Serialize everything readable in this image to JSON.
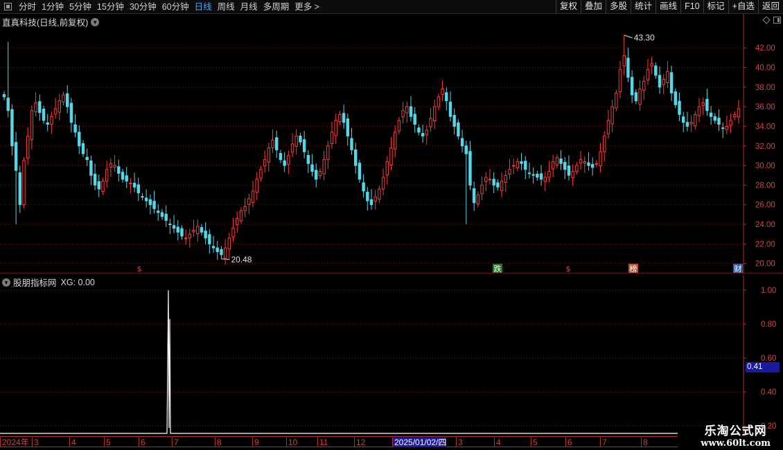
{
  "toolbar": {
    "periods": [
      "分时",
      "1分钟",
      "5分钟",
      "15分钟",
      "30分钟",
      "60分钟",
      "日线",
      "周线",
      "月线",
      "多周期",
      "更多 >"
    ],
    "active_period": "日线",
    "actions": [
      "复权",
      "叠加",
      "多股",
      "统计",
      "画线",
      "F10",
      "标记",
      "+自选",
      "返回"
    ]
  },
  "price_panel": {
    "title": "直真科技(日线,前复权)",
    "high_label": "43.30",
    "low_label": "20.48",
    "markers": [
      {
        "text": "$",
        "color": "#ff3b3b",
        "bg": "transparent"
      },
      {
        "text": "跌",
        "color": "#ffffff",
        "bg": "#1f7a1f"
      },
      {
        "text": "$",
        "color": "#ff3b3b",
        "bg": "transparent"
      },
      {
        "text": "榜",
        "color": "#ffffff",
        "bg": "#c0502a"
      },
      {
        "text": "财",
        "color": "#ffffff",
        "bg": "#2a5fb0"
      }
    ]
  },
  "indicator_panel": {
    "title": "股朋指标网",
    "value_label": "XG: 0.00",
    "current_value": "0.41"
  },
  "date_axis": [
    "2024年",
    "3",
    "4",
    "5",
    "6",
    "7",
    "8",
    "9",
    "10",
    "11",
    "12",
    "2025/01/02/四",
    "3",
    "4",
    "5",
    "6",
    "7",
    "8"
  ],
  "watermark": {
    "line1": "乐淘公式网",
    "line2": "www.60lt.com"
  },
  "colors": {
    "up": "#ff3b3b",
    "down": "#54d8e8",
    "grid": "#7a1515",
    "axis": "#b03030",
    "accent": "#4aa3ff"
  },
  "chart_data": [
    {
      "type": "candlestick",
      "title": "直真科技(日线,前复权)",
      "y_ticks": [
        "20.00",
        "22.00",
        "24.00",
        "26.00",
        "28.00",
        "30.00",
        "32.00",
        "34.00",
        "36.00",
        "38.00",
        "40.00",
        "42.00"
      ],
      "ylim": [
        19.2,
        44.2
      ],
      "x_labels": [
        "2024年",
        "3",
        "4",
        "5",
        "6",
        "7",
        "8",
        "9",
        "10",
        "11",
        "12",
        "2025/01/02/四",
        "3",
        "4",
        "5",
        "6",
        "7",
        "8"
      ],
      "grid": true,
      "closes": [
        37.0,
        35.6,
        32.0,
        29.5,
        26.0,
        30.5,
        33.0,
        35.6,
        36.4,
        35.4,
        34.6,
        34.2,
        35.0,
        35.8,
        36.6,
        37.2,
        36.0,
        34.4,
        33.4,
        32.0,
        31.2,
        30.6,
        29.0,
        28.0,
        27.6,
        28.4,
        29.6,
        30.2,
        30.0,
        29.2,
        28.6,
        28.4,
        28.2,
        27.8,
        27.2,
        26.8,
        26.4,
        26.0,
        25.6,
        25.2,
        24.8,
        24.4,
        24.0,
        23.6,
        23.2,
        22.8,
        22.6,
        23.0,
        23.4,
        23.8,
        23.2,
        22.6,
        22.0,
        21.6,
        21.2,
        20.9,
        21.6,
        22.6,
        23.6,
        24.6,
        25.4,
        25.8,
        26.6,
        27.4,
        28.6,
        29.6,
        30.6,
        31.8,
        32.6,
        31.6,
        30.6,
        30.0,
        31.0,
        32.2,
        33.0,
        32.4,
        31.4,
        30.2,
        29.4,
        28.6,
        29.4,
        30.6,
        32.0,
        33.4,
        34.6,
        35.2,
        34.4,
        33.0,
        31.6,
        30.0,
        28.6,
        27.4,
        26.4,
        26.0,
        26.8,
        27.6,
        28.8,
        30.4,
        31.8,
        33.4,
        34.6,
        35.6,
        36.0,
        35.0,
        34.2,
        33.4,
        33.0,
        33.6,
        34.8,
        36.0,
        37.0,
        37.8,
        36.6,
        35.0,
        34.0,
        33.0,
        32.0,
        31.2,
        28.0,
        26.2,
        27.0,
        28.0,
        28.8,
        28.6,
        28.0,
        27.8,
        28.4,
        29.0,
        29.6,
        30.0,
        30.4,
        30.2,
        29.6,
        29.2,
        29.0,
        28.8,
        28.6,
        28.8,
        29.4,
        30.4,
        30.8,
        30.2,
        29.6,
        29.0,
        29.4,
        30.0,
        30.6,
        30.4,
        30.0,
        29.8,
        30.2,
        31.4,
        33.0,
        34.6,
        36.0,
        37.4,
        39.8,
        41.2,
        39.0,
        37.2,
        36.6,
        37.8,
        38.6,
        39.8,
        40.4,
        39.2,
        38.0,
        38.8,
        39.6,
        37.4,
        36.2,
        35.2,
        34.4,
        34.0,
        34.4,
        35.2,
        36.0,
        36.4,
        35.6,
        35.0,
        34.6,
        34.2,
        33.8,
        34.0,
        34.6,
        35.2,
        35.8
      ],
      "extremes": {
        "high": 43.3,
        "low": 20.48
      }
    },
    {
      "type": "line",
      "series": [
        {
          "name": "XG",
          "values_note": "0 except spike"
        }
      ],
      "y_ticks": [
        "0.20",
        "0.40",
        "0.60",
        "0.80",
        "1.00"
      ],
      "ylim": [
        0.16,
        1.05
      ],
      "spike": {
        "value": 1.0,
        "after_value": 0.83
      },
      "current": 0.41
    }
  ]
}
